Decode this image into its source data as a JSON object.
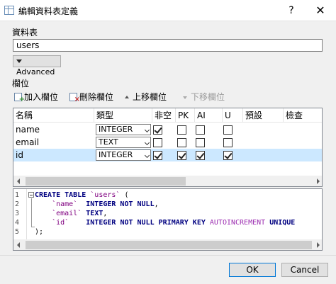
{
  "window": {
    "title": "編輯資料表定義",
    "help_label": "?",
    "close_label": "✕"
  },
  "table_name": {
    "label": "資料表",
    "value": "users",
    "advanced_label": "Advanced"
  },
  "fields": {
    "label": "欄位",
    "toolbar": {
      "add": "加入欄位",
      "remove": "刪除欄位",
      "move_up": "上移欄位",
      "move_down": "下移欄位"
    },
    "columns": [
      "名稱",
      "類型",
      "非空",
      "PK",
      "AI",
      "U",
      "預設",
      "檢查"
    ],
    "rows": [
      {
        "name": "name",
        "type": "INTEGER",
        "not_null": true,
        "pk": false,
        "ai": false,
        "u": false,
        "selected": false
      },
      {
        "name": "email",
        "type": "TEXT",
        "not_null": false,
        "pk": false,
        "ai": false,
        "u": false,
        "selected": false
      },
      {
        "name": "id",
        "type": "INTEGER",
        "not_null": true,
        "pk": true,
        "ai": true,
        "u": true,
        "selected": true
      }
    ]
  },
  "sql": {
    "line_numbers": [
      "1",
      "2",
      "3",
      "4",
      "5"
    ],
    "line1": {
      "kw": "CREATE TABLE",
      "name": "`users`",
      "rest": " ("
    },
    "line2": {
      "name": "`name`",
      "type": "INTEGER NOT NULL",
      "end": ","
    },
    "line3": {
      "name": "`email`",
      "type": "TEXT",
      "end": ","
    },
    "line4": {
      "name": "`id`",
      "type": "INTEGER NOT NULL PRIMARY KEY",
      "ai": "AUTOINCREMENT",
      "unique": "UNIQUE"
    },
    "line5": ");"
  },
  "buttons": {
    "ok": "OK",
    "cancel": "Cancel"
  },
  "colors": {
    "selection": "#cce8ff",
    "default_button_border": "#0078d7",
    "keyword": "#000080",
    "identifier": "#800080"
  }
}
